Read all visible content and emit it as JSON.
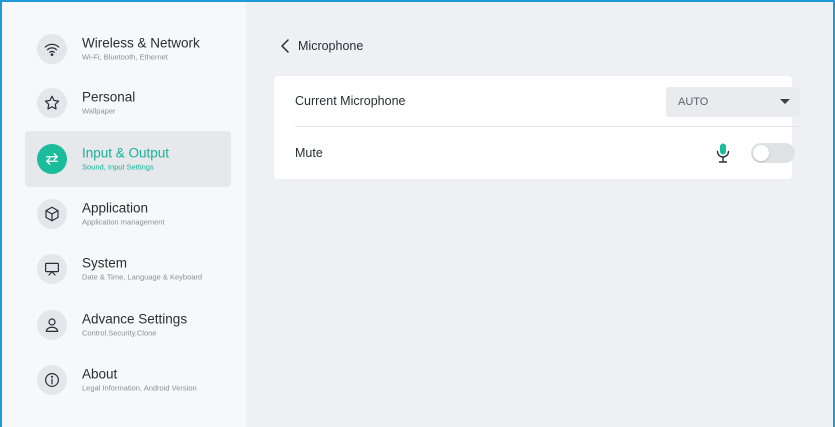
{
  "sidebar": {
    "items": [
      {
        "title": "Wireless & Network",
        "subtitle": "Wi-Fi, Bluetooth, Ethernet",
        "icon": "wifi-icon",
        "active": false
      },
      {
        "title": "Personal",
        "subtitle": "Wallpaper",
        "icon": "star-icon",
        "active": false
      },
      {
        "title": "Input & Output",
        "subtitle": "Sound, Input Settings",
        "icon": "swap-arrows-icon",
        "active": true
      },
      {
        "title": "Application",
        "subtitle": "Application management",
        "icon": "cube-icon",
        "active": false
      },
      {
        "title": "System",
        "subtitle": "Date & Time, Language & Keyboard",
        "icon": "monitor-icon",
        "active": false
      },
      {
        "title": "Advance Settings",
        "subtitle": "Control,Security,Clone",
        "icon": "user-icon",
        "active": false
      },
      {
        "title": "About",
        "subtitle": "Legal Information, Android Version",
        "icon": "info-icon",
        "active": false
      }
    ]
  },
  "page": {
    "back_title": "Microphone"
  },
  "settings": {
    "current_microphone": {
      "label": "Current Microphone",
      "value": "AUTO"
    },
    "mute": {
      "label": "Mute",
      "enabled": false
    }
  },
  "colors": {
    "accent": "#1abc9c",
    "frame": "#1e9ad8"
  }
}
